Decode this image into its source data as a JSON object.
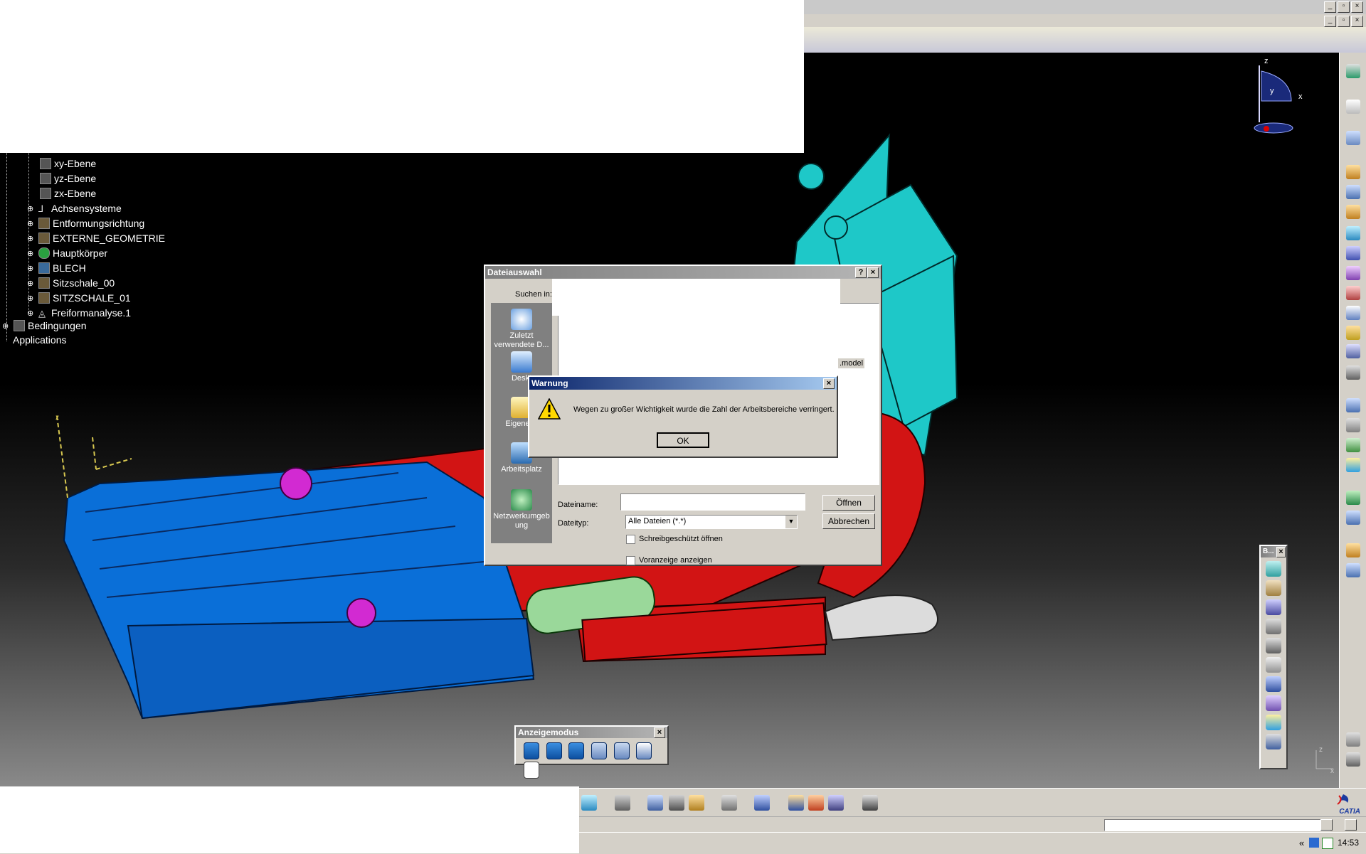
{
  "window": {
    "controls_outer": [
      "_",
      "▫",
      "×"
    ],
    "controls_inner": [
      "_",
      "▫",
      "×"
    ]
  },
  "tree": {
    "items": [
      {
        "label": "xy-Ebene",
        "icon": "plane-icon"
      },
      {
        "label": "yz-Ebene",
        "icon": "plane-icon"
      },
      {
        "label": "zx-Ebene",
        "icon": "plane-icon"
      },
      {
        "label": "Achsensysteme",
        "icon": "axis-system-icon"
      },
      {
        "label": "Entformungsrichtung",
        "icon": "geometric-set-icon"
      },
      {
        "label": "EXTERNE_GEOMETRIE",
        "icon": "geometric-set-icon"
      },
      {
        "label": "Hauptkörper",
        "icon": "body-icon"
      },
      {
        "label": "BLECH",
        "icon": "geometric-set-icon"
      },
      {
        "label": "Sitzschale_00",
        "icon": "geometric-set-icon"
      },
      {
        "label": "SITZSCHALE_01",
        "icon": "geometric-set-icon"
      },
      {
        "label": "Freiformanalyse.1",
        "icon": "analysis-icon"
      }
    ],
    "root_items": [
      {
        "label": "Bedingungen",
        "icon": "constraints-icon"
      },
      {
        "label": "Applications",
        "icon": ""
      }
    ]
  },
  "compass": {
    "x": "x",
    "y": "y",
    "z": "z"
  },
  "axis_indicator": {
    "x": "x",
    "y": "y",
    "z": "z"
  },
  "file_dialog": {
    "title": "Dateiauswahl",
    "look_in_label": "Suchen in:",
    "places": [
      {
        "label": "Zuletzt verwendete D...",
        "icon": "recent-icon"
      },
      {
        "label": "Deskt",
        "icon": "desktop-icon"
      },
      {
        "label": "Eigene D",
        "icon": "my-documents-icon"
      },
      {
        "label": "Arbeitsplatz",
        "icon": "my-computer-icon"
      },
      {
        "label": "Netzwerkumgeb ung",
        "icon": "network-icon"
      }
    ],
    "file_item": ".model",
    "filename_label": "Dateiname:",
    "filename_value": "",
    "filetype_label": "Dateityp:",
    "filetype_value": "Alle Dateien (*.*)",
    "readonly_label": "Schreibgeschützt öffnen",
    "readonly_checked": false,
    "preview_label": "Voranzeige anzeigen",
    "preview_checked": false,
    "open_button": "Öffnen",
    "cancel_button": "Abbrechen",
    "help_button": "?",
    "close_button": "×"
  },
  "warning_dialog": {
    "title": "Warnung",
    "message": "Wegen zu großer Wichtigkeit wurde die Zahl der Arbeitsbereiche verringert.",
    "ok_button": "OK",
    "close_button": "×"
  },
  "display_mode_toolbar": {
    "title": "Anzeigemodus",
    "close_button": "×",
    "tools": [
      "shading-icon",
      "shading-with-edges-icon",
      "shading-without-hidden-edges-icon",
      "wireframe-icon",
      "hidden-edges-icon",
      "material-icon",
      "custom-view-icon"
    ]
  },
  "vertical_toolbar": {
    "title": "B...",
    "close_button": "×"
  },
  "brand": {
    "logo_text": "CATIA"
  },
  "taskbar": {
    "chevron": "«",
    "clock": "14:53"
  },
  "colors": {
    "seat_blue": "#0a6fd8",
    "mechanism_red": "#d21414",
    "backrest_cyan": "#1ec8c8",
    "actuator_green": "#9ad89a",
    "title_active": "#0a246a",
    "dialog_gray": "#d4d0c8"
  }
}
